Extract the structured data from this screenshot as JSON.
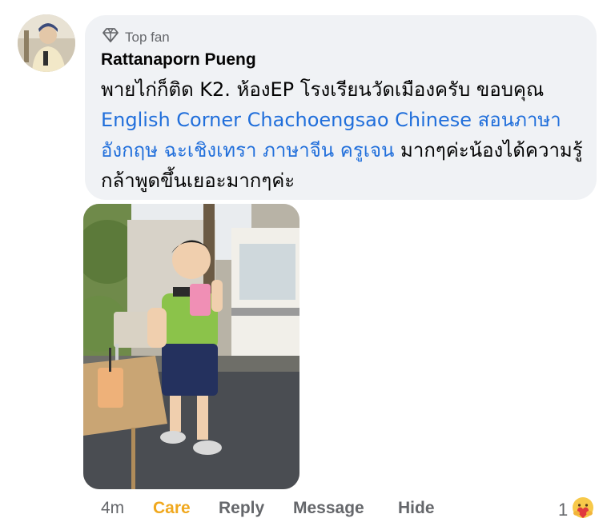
{
  "comment": {
    "badge": "Top fan",
    "badge_icon": "diamond-icon",
    "author": "Rattanaporn Pueng",
    "text_part1": "พายไก่ก็ติด K2. ห้องEP โรงเรียนวัดเมืองครับ ขอบคุณ ",
    "link_text": "English Corner Chachoengsao Chinese สอนภาษาอังกฤษ ฉะเชิงเทรา ภาษาจีน ครูเจน",
    "text_part2": " มากๆค่ะน้องได้ความรู้ กล้าพูดขึ้นเยอะมากๆค่ะ",
    "link_color": "#216fdb"
  },
  "actions": {
    "time": "4m",
    "care": "Care",
    "care_color": "#f0a81e",
    "reply": "Reply",
    "message": "Message",
    "hide": "Hide"
  },
  "reactions": {
    "count": "1",
    "icon": "care-reaction-icon"
  }
}
